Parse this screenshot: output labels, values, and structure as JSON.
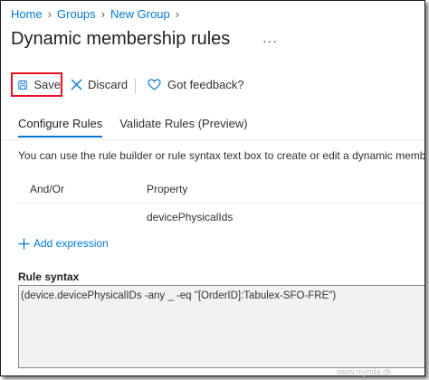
{
  "breadcrumb": {
    "items": [
      "Home",
      "Groups",
      "New Group"
    ]
  },
  "page": {
    "title": "Dynamic membership rules",
    "more_label": "···"
  },
  "toolbar": {
    "save_label": "Save",
    "discard_label": "Discard",
    "feedback_label": "Got feedback?"
  },
  "tabs": [
    {
      "label": "Configure Rules",
      "active": true
    },
    {
      "label": "Validate Rules (Preview)",
      "active": false
    }
  ],
  "description": "You can use the rule builder or rule syntax text box to create or edit a dynamic membershi",
  "rule_table": {
    "columns": [
      "And/Or",
      "Property"
    ],
    "rows": [
      {
        "and_or": "",
        "property": "devicePhysicalIds"
      }
    ]
  },
  "add_expression_label": "Add expression",
  "rule_syntax": {
    "label": "Rule syntax",
    "value": "(device.devicePhysicalIDs -any _ -eq \"[OrderID]:Tabulex-SFO-FRE\")"
  },
  "watermark_text": "www.mynda.dk",
  "colors": {
    "accent": "#0078d4",
    "highlight_border": "#e81123",
    "text": "#323130"
  },
  "icons": {
    "save": "save-icon",
    "discard": "close-icon",
    "feedback": "heart-icon",
    "add": "plus-icon",
    "breadcrumb_separator": "chevron-right-icon"
  }
}
